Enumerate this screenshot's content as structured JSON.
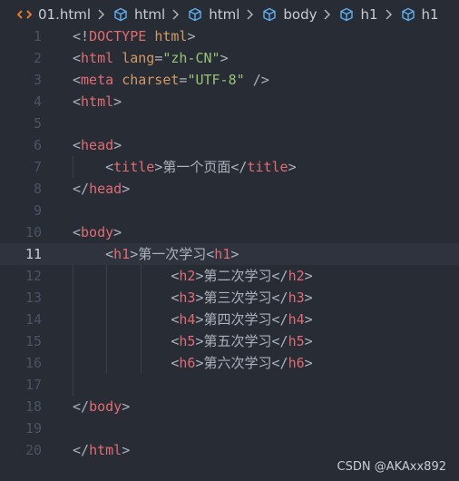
{
  "breadcrumb": {
    "file": "01.html",
    "items": [
      "html",
      "html",
      "body",
      "h1",
      "h1"
    ]
  },
  "lines": [
    {
      "num": "1",
      "tokens": [
        [
          "punc",
          "<!"
        ],
        [
          "tag",
          "DOCTYPE"
        ],
        [
          "txt",
          " "
        ],
        [
          "attr",
          "html"
        ],
        [
          "punc",
          ">"
        ]
      ]
    },
    {
      "num": "2",
      "tokens": [
        [
          "punc",
          "<"
        ],
        [
          "tag",
          "html"
        ],
        [
          "txt",
          " "
        ],
        [
          "attr",
          "lang"
        ],
        [
          "punc",
          "="
        ],
        [
          "str",
          "\"zh-CN\""
        ],
        [
          "punc",
          ">"
        ]
      ]
    },
    {
      "num": "3",
      "tokens": [
        [
          "punc",
          "<"
        ],
        [
          "tag",
          "meta"
        ],
        [
          "txt",
          " "
        ],
        [
          "attr",
          "charset"
        ],
        [
          "punc",
          "="
        ],
        [
          "str",
          "\"UTF-8\""
        ],
        [
          "txt",
          " "
        ],
        [
          "punc",
          "/>"
        ]
      ]
    },
    {
      "num": "4",
      "tokens": [
        [
          "punc",
          "<"
        ],
        [
          "tag",
          "html"
        ],
        [
          "punc",
          ">"
        ]
      ]
    },
    {
      "num": "5",
      "tokens": []
    },
    {
      "num": "6",
      "tokens": [
        [
          "punc",
          "<"
        ],
        [
          "tag",
          "head"
        ],
        [
          "punc",
          ">"
        ]
      ]
    },
    {
      "num": "7",
      "tokens": [
        [
          "txt",
          "    "
        ],
        [
          "punc",
          "<"
        ],
        [
          "tag",
          "title"
        ],
        [
          "punc",
          ">"
        ],
        [
          "txt",
          "第一个页面"
        ],
        [
          "punc",
          "</"
        ],
        [
          "tag",
          "title"
        ],
        [
          "punc",
          ">"
        ]
      ]
    },
    {
      "num": "8",
      "tokens": [
        [
          "punc",
          "</"
        ],
        [
          "tag",
          "head"
        ],
        [
          "punc",
          ">"
        ]
      ]
    },
    {
      "num": "9",
      "tokens": []
    },
    {
      "num": "10",
      "tokens": [
        [
          "punc",
          "<"
        ],
        [
          "tag",
          "body"
        ],
        [
          "punc",
          ">"
        ]
      ]
    },
    {
      "num": "11",
      "tokens": [
        [
          "txt",
          "    "
        ],
        [
          "punc",
          "<"
        ],
        [
          "tag",
          "h1"
        ],
        [
          "punc",
          ">"
        ],
        [
          "txt",
          "第一次学习"
        ],
        [
          "punc",
          "<"
        ],
        [
          "tag",
          "h1"
        ],
        [
          "punc",
          ">"
        ]
      ]
    },
    {
      "num": "12",
      "tokens": [
        [
          "txt",
          "            "
        ],
        [
          "punc",
          "<"
        ],
        [
          "tag",
          "h2"
        ],
        [
          "punc",
          ">"
        ],
        [
          "txt",
          "第二次学习"
        ],
        [
          "punc",
          "</"
        ],
        [
          "tag",
          "h2"
        ],
        [
          "punc",
          ">"
        ]
      ]
    },
    {
      "num": "13",
      "tokens": [
        [
          "txt",
          "            "
        ],
        [
          "punc",
          "<"
        ],
        [
          "tag",
          "h3"
        ],
        [
          "punc",
          ">"
        ],
        [
          "txt",
          "第三次学习"
        ],
        [
          "punc",
          "</"
        ],
        [
          "tag",
          "h3"
        ],
        [
          "punc",
          ">"
        ]
      ]
    },
    {
      "num": "14",
      "tokens": [
        [
          "txt",
          "            "
        ],
        [
          "punc",
          "<"
        ],
        [
          "tag",
          "h4"
        ],
        [
          "punc",
          ">"
        ],
        [
          "txt",
          "第四次学习"
        ],
        [
          "punc",
          "</"
        ],
        [
          "tag",
          "h4"
        ],
        [
          "punc",
          ">"
        ]
      ]
    },
    {
      "num": "15",
      "tokens": [
        [
          "txt",
          "            "
        ],
        [
          "punc",
          "<"
        ],
        [
          "tag",
          "h5"
        ],
        [
          "punc",
          ">"
        ],
        [
          "txt",
          "第五次学习"
        ],
        [
          "punc",
          "</"
        ],
        [
          "tag",
          "h5"
        ],
        [
          "punc",
          ">"
        ]
      ]
    },
    {
      "num": "16",
      "tokens": [
        [
          "txt",
          "            "
        ],
        [
          "punc",
          "<"
        ],
        [
          "tag",
          "h6"
        ],
        [
          "punc",
          ">"
        ],
        [
          "txt",
          "第六次学习"
        ],
        [
          "punc",
          "</"
        ],
        [
          "tag",
          "h6"
        ],
        [
          "punc",
          ">"
        ]
      ]
    },
    {
      "num": "17",
      "tokens": []
    },
    {
      "num": "18",
      "tokens": [
        [
          "punc",
          "</"
        ],
        [
          "tag",
          "body"
        ],
        [
          "punc",
          ">"
        ]
      ]
    },
    {
      "num": "19",
      "tokens": []
    },
    {
      "num": "20",
      "tokens": [
        [
          "punc",
          "</"
        ],
        [
          "tag",
          "html"
        ],
        [
          "punc",
          ">"
        ]
      ]
    }
  ],
  "active_line": "11",
  "watermark": "CSDN @AKAxx892"
}
